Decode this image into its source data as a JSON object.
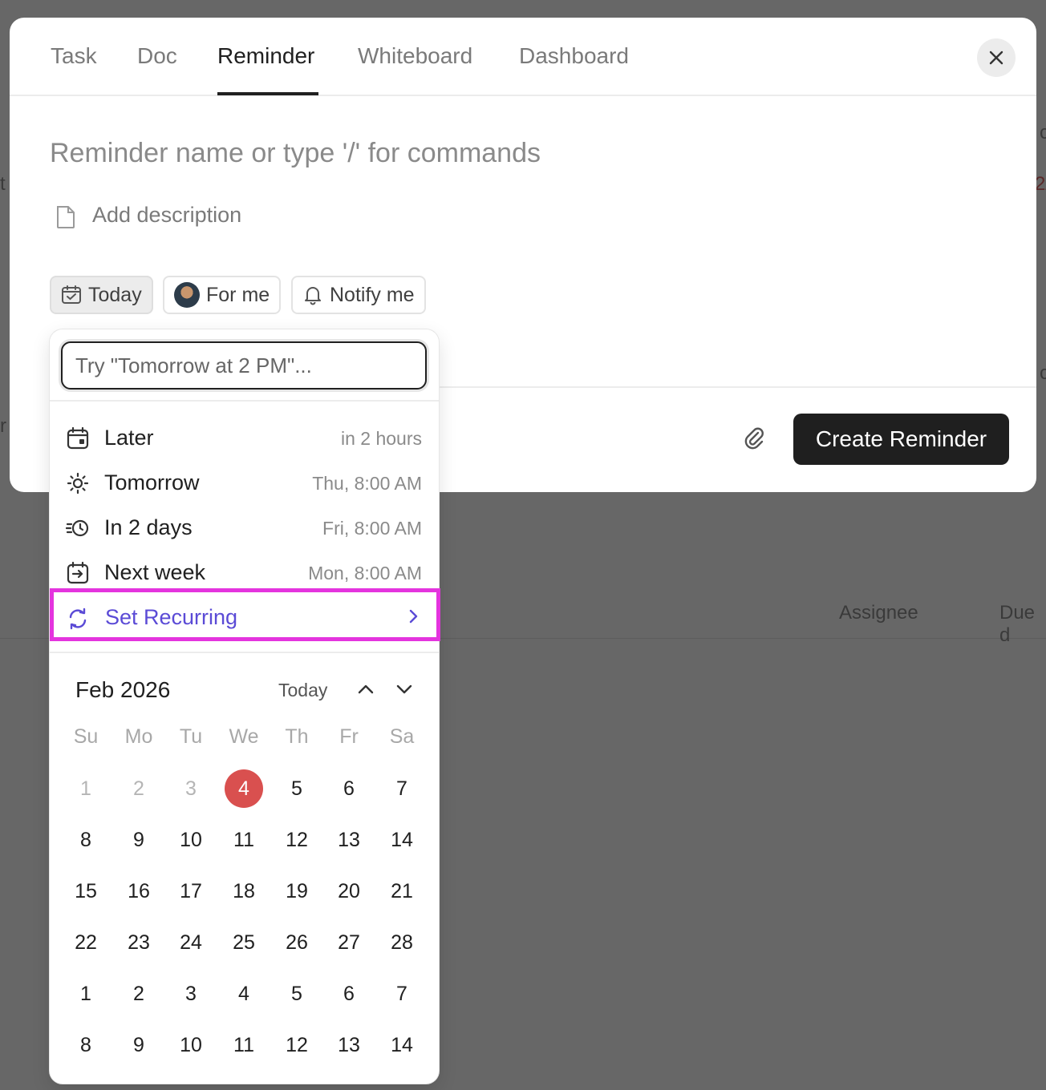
{
  "background": {
    "fragments": [
      "t",
      "r",
      "c",
      "c",
      "2/"
    ],
    "columns": [
      "Assignee",
      "Due d"
    ]
  },
  "tabs": [
    {
      "label": "Task",
      "active": false
    },
    {
      "label": "Doc",
      "active": false
    },
    {
      "label": "Reminder",
      "active": true
    },
    {
      "label": "Whiteboard",
      "active": false
    },
    {
      "label": "Dashboard",
      "active": false
    }
  ],
  "close_icon": "close-icon",
  "reminder": {
    "name_placeholder": "Reminder name or type '/' for commands",
    "description_placeholder": "Add description"
  },
  "chips": {
    "date": "Today",
    "assignee": "For me",
    "notify": "Notify me"
  },
  "footer": {
    "create_label": "Create Reminder"
  },
  "date_picker": {
    "input_placeholder": "Try \"Tomorrow at 2 PM\"...",
    "options": [
      {
        "label": "Later",
        "time": "in 2 hours",
        "icon": "calendar-clock-icon"
      },
      {
        "label": "Tomorrow",
        "time": "Thu, 8:00 AM",
        "icon": "sun-icon"
      },
      {
        "label": "In 2 days",
        "time": "Fri, 8:00 AM",
        "icon": "fast-clock-icon"
      },
      {
        "label": "Next week",
        "time": "Mon, 8:00 AM",
        "icon": "calendar-arrow-icon"
      }
    ],
    "recurring_label": "Set Recurring",
    "accent_color": "#5b4bd6",
    "highlight_color": "#e434de"
  },
  "calendar": {
    "month_label": "Feb 2026",
    "today_label": "Today",
    "weekdays": [
      "Su",
      "Mo",
      "Tu",
      "We",
      "Th",
      "Fr",
      "Sa"
    ],
    "weeks": [
      [
        "1",
        "2",
        "3",
        "4",
        "5",
        "6",
        "7"
      ],
      [
        "8",
        "9",
        "10",
        "11",
        "12",
        "13",
        "14"
      ],
      [
        "15",
        "16",
        "17",
        "18",
        "19",
        "20",
        "21"
      ],
      [
        "22",
        "23",
        "24",
        "25",
        "26",
        "27",
        "28"
      ],
      [
        "1",
        "2",
        "3",
        "4",
        "5",
        "6",
        "7"
      ],
      [
        "8",
        "9",
        "10",
        "11",
        "12",
        "13",
        "14"
      ]
    ],
    "muted": [
      [
        0,
        0
      ],
      [
        0,
        1
      ],
      [
        0,
        2
      ]
    ],
    "today": [
      0,
      3
    ],
    "today_color": "#d9504f"
  }
}
